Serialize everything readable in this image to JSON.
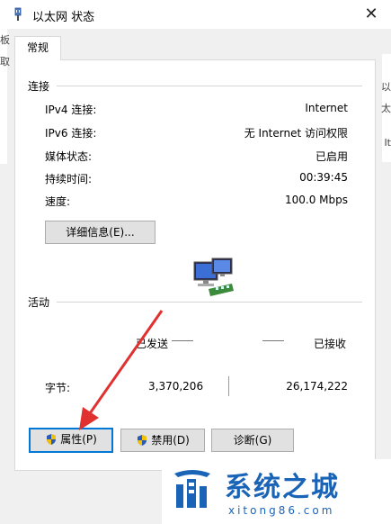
{
  "window": {
    "title": "以太网 状态",
    "close_glyph": "✕"
  },
  "background_fragments": {
    "left": [
      "板",
      "取"
    ],
    "right": [
      "以",
      "太",
      "It"
    ]
  },
  "tabs": [
    {
      "label": "常规"
    }
  ],
  "connection": {
    "group_title": "连接",
    "rows": [
      {
        "label": "IPv4 连接:",
        "value": "Internet"
      },
      {
        "label": "IPv6 连接:",
        "value": "无 Internet 访问权限"
      },
      {
        "label": "媒体状态:",
        "value": "已启用"
      },
      {
        "label": "持续时间:",
        "value": "00:39:45"
      },
      {
        "label": "速度:",
        "value": "100.0 Mbps"
      }
    ],
    "details_button": "详细信息(E)..."
  },
  "activity": {
    "group_title": "活动",
    "sent_label": "已发送",
    "received_label": "已接收",
    "bytes_label": "字节:",
    "bytes_sent": "3,370,206",
    "bytes_received": "26,174,222"
  },
  "buttons": {
    "properties": "属性(P)",
    "disable": "禁用(D)",
    "diagnose": "诊断(G)"
  },
  "watermark": {
    "text": "系统之城",
    "url": "xitong86.com"
  },
  "colors": {
    "accent": "#0078d7",
    "arrow": "#e03030",
    "watermark": "#1a64b8"
  }
}
